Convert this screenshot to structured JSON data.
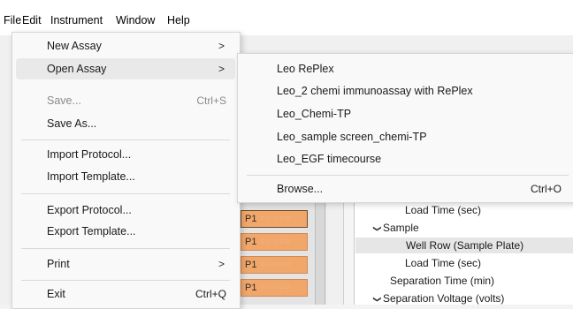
{
  "menubar": {
    "items": [
      "File",
      "Edit",
      "Instrument",
      "Window",
      "Help"
    ]
  },
  "file_menu": {
    "new_assay": "New Assay",
    "open_assay": "Open Assay",
    "save": "Save...",
    "save_shortcut": "Ctrl+S",
    "save_as": "Save As...",
    "import_protocol": "Import Protocol...",
    "import_template": "Import Template...",
    "export_protocol": "Export Protocol...",
    "export_template": "Export Template...",
    "print": "Print",
    "exit": "Exit",
    "exit_shortcut": "Ctrl+Q",
    "submenu_arrow": ">"
  },
  "open_assay_submenu": {
    "recent": [
      "Leo RePlex",
      "Leo_2 chemi immunoassay with RePlex",
      "Leo_Chemi-TP",
      "Leo_sample screen_chemi-TP",
      "Leo_EGF timecourse"
    ],
    "browse": "Browse...",
    "browse_shortcut": "Ctrl+O"
  },
  "plate": {
    "rows": [
      "P1",
      "P1",
      "P1",
      "P1"
    ],
    "circles": "○○○○○"
  },
  "protocol_tree": {
    "load_time_1": "Load Time (sec)",
    "sample": "Sample",
    "well_row": "Well Row (Sample Plate)",
    "load_time_2": "Load Time (sec)",
    "separation_time": "Separation Time (min)",
    "separation_voltage": "Separation Voltage (volts)"
  },
  "icons": {
    "expand": "chevron-down-icon"
  }
}
